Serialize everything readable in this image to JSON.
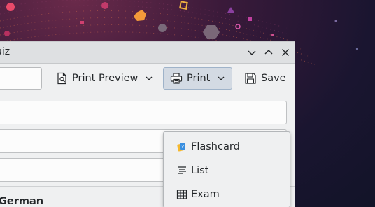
{
  "window": {
    "title_fragment": "uiz"
  },
  "toolbar": {
    "print_preview_label": "Print Preview",
    "print_label": "Print",
    "save_label": "Save"
  },
  "print_menu": {
    "items": [
      {
        "label": "Flashcard",
        "icon": "flashcard-icon"
      },
      {
        "label": "List",
        "icon": "list-icon"
      },
      {
        "label": "Exam",
        "icon": "table-icon"
      }
    ]
  },
  "form": {
    "language_label": "German"
  },
  "colors": {
    "window_bg": "#eff0f1",
    "titlebar_bg": "#dee0e2",
    "pressed_button_bg": "#d3dae3",
    "text": "#232629"
  }
}
